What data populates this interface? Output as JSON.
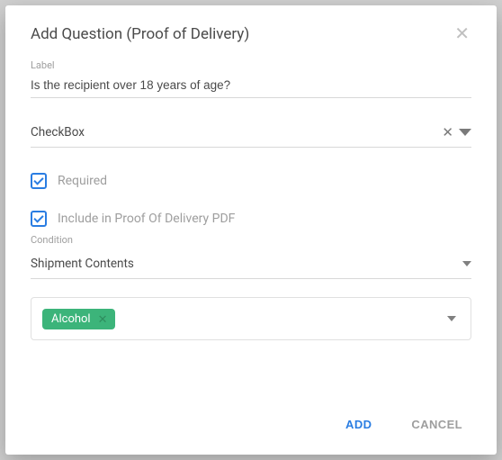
{
  "modal": {
    "title": "Add Question (Proof of Delivery)"
  },
  "form": {
    "label_caption": "Label",
    "label_value": "Is the recipient over 18 years of age?",
    "type_value": "CheckBox",
    "required_label": "Required",
    "required_checked": true,
    "include_pdf_label": "Include in Proof Of Delivery PDF",
    "include_pdf_checked": true,
    "condition_caption": "Condition",
    "condition_value": "Shipment Contents",
    "tags": [
      {
        "name": "Alcohol"
      }
    ]
  },
  "buttons": {
    "add": "ADD",
    "cancel": "CANCEL"
  }
}
